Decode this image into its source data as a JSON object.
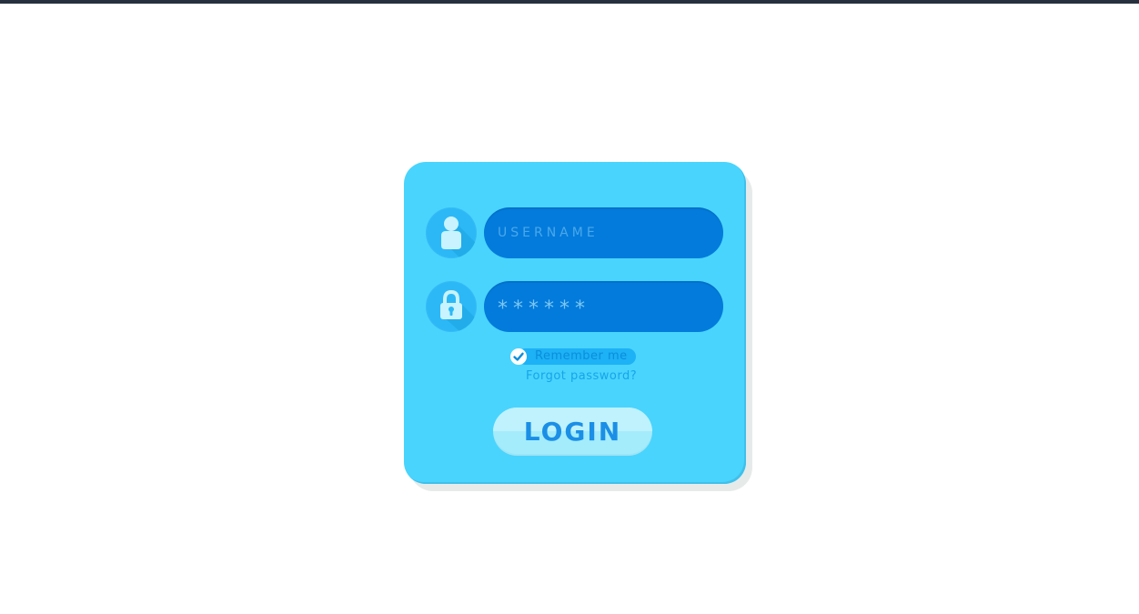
{
  "form": {
    "username_placeholder": "USERNAME",
    "password_value": "******",
    "remember_label": "Remember me",
    "remember_checked": true,
    "forgot_label": "Forgot password?",
    "login_label": "LOGIN"
  },
  "icons": {
    "user": "user-icon",
    "lock": "lock-icon",
    "check": "check-icon"
  },
  "colors": {
    "card": "#49d4fd",
    "field": "#037bdc",
    "icon_circle": "#2cb8f6",
    "button": "#a4ecfc",
    "button_text": "#1b8fe6"
  }
}
